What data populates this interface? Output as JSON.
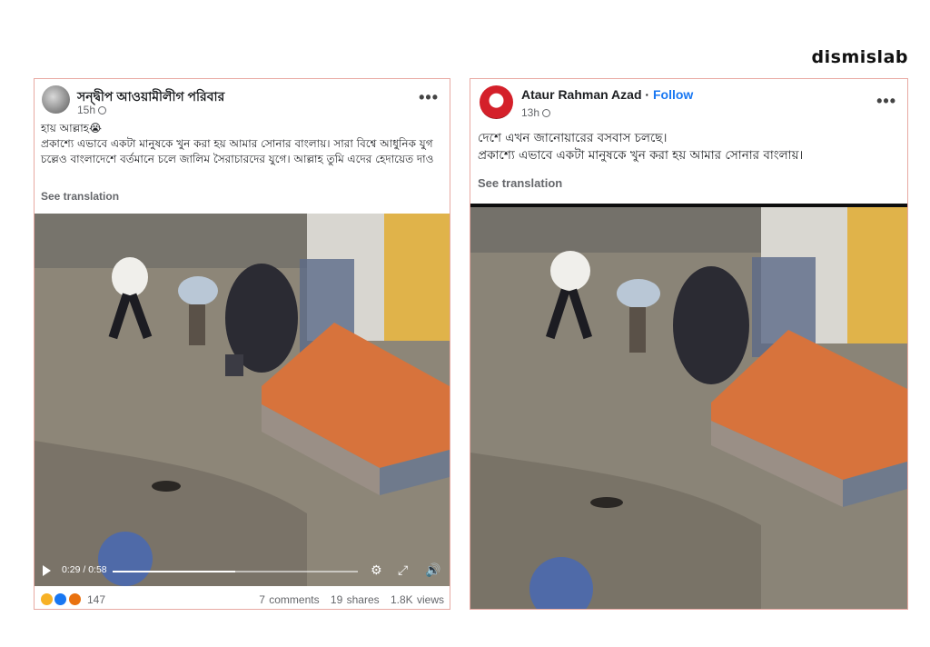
{
  "brand": "dismislab",
  "left_post": {
    "author": "সন্দ্বীপ আওয়ামীলীগ পরিবার",
    "time": "15h",
    "line1": "হায় আল্লাহ😭",
    "body": "প্রকাশ্যে এভাবে একটা মানুষকে খুন করা হয় আমার সোনার বাংলায়। সারা বিশ্বে আধুনিক যুগ চল্লেও বাংলাদেশে বর্তমানে চলে জালিম সৈরাচারদের যুগে। আল্লাহ তুমি এদের হেদায়েত দাও",
    "see_translation": "See translation",
    "video": {
      "time_label": "0:29 / 0:58",
      "progress": 0.5
    },
    "reaction_count": "147",
    "comments": "7 comments",
    "shares": "19 shares",
    "views": "1.8K views",
    "reaction_icons": [
      "haha-icon",
      "like-icon",
      "angry-icon"
    ]
  },
  "right_post": {
    "author": "Ataur Rahman Azad",
    "separator": " · ",
    "follow": "Follow",
    "time": "13h",
    "line1": "দেশে এখন জানোয়ারের বসবাস চলছে।",
    "line2": "প্রকাশ্যে এভাবে একটা মানুষকে খুন করা হয় আমার সোনার বাংলায়।",
    "see_translation": "See translation"
  },
  "colors": {
    "card_border": "#e8a9a2",
    "link_blue": "#1877f2",
    "step_orange": "#e2743a",
    "door_yellow": "#e0b34a"
  }
}
